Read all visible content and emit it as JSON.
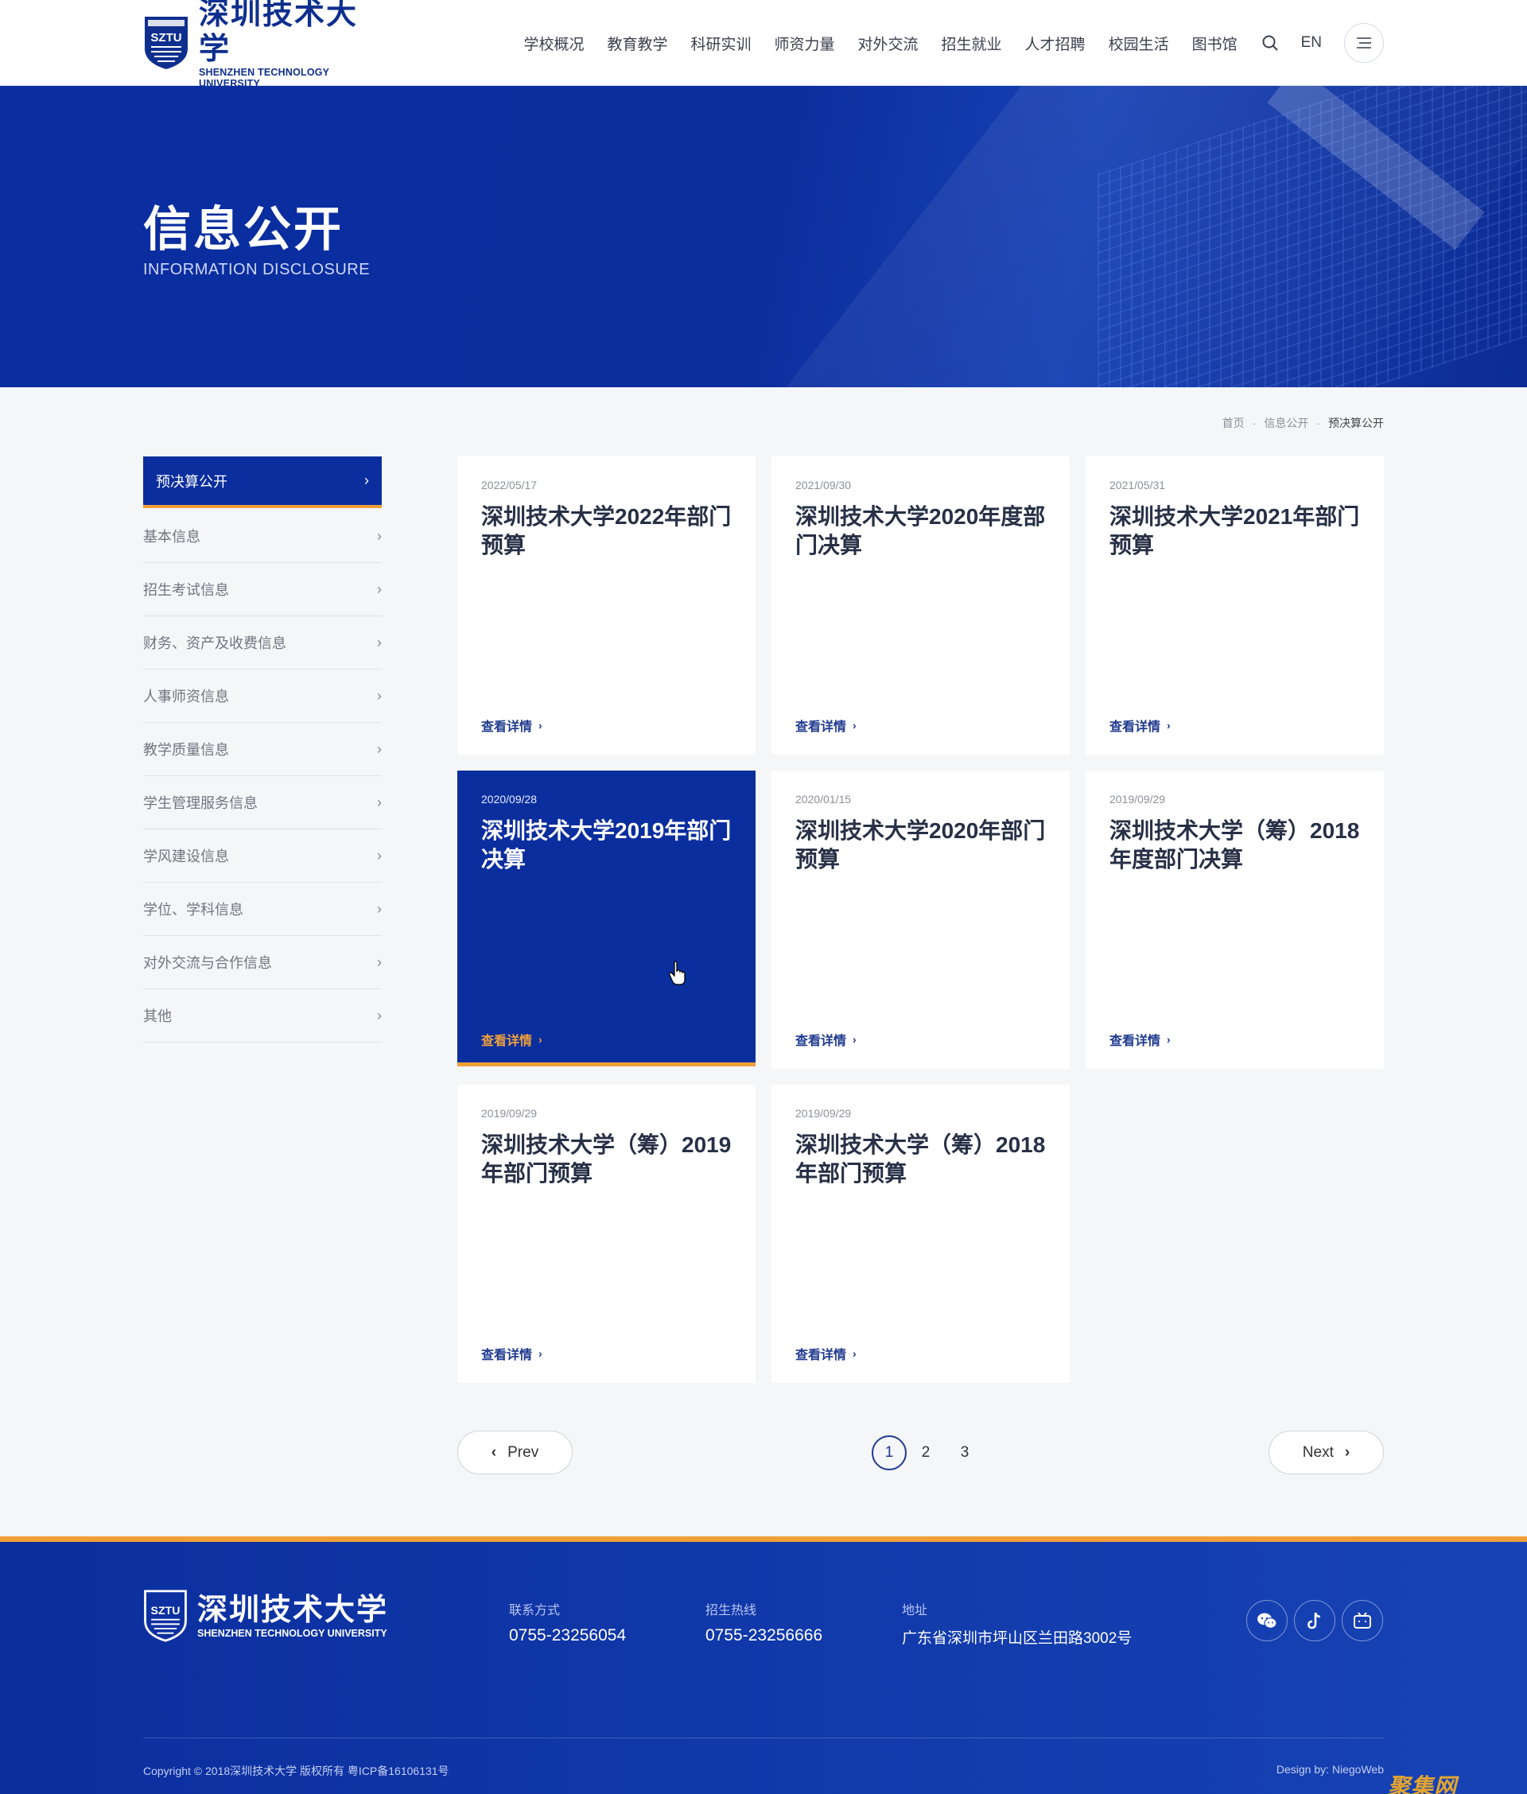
{
  "header": {
    "logo_cn": "深圳技术大学",
    "logo_en": "SHENZHEN TECHNOLOGY UNIVERSITY",
    "logo_abbr": "SZTU",
    "nav": [
      "学校概况",
      "教育教学",
      "科研实训",
      "师资力量",
      "对外交流",
      "招生就业",
      "人才招聘",
      "校园生活",
      "图书馆"
    ],
    "lang": "EN"
  },
  "banner": {
    "title": "信息公开",
    "subtitle": "INFORMATION DISCLOSURE"
  },
  "breadcrumb": [
    "首页",
    "信息公开",
    "预决算公开"
  ],
  "sidebar": {
    "items": [
      {
        "label": "预决算公开",
        "active": true
      },
      {
        "label": "基本信息"
      },
      {
        "label": "招生考试信息"
      },
      {
        "label": "财务、资产及收费信息"
      },
      {
        "label": "人事师资信息"
      },
      {
        "label": "教学质量信息"
      },
      {
        "label": "学生管理服务信息"
      },
      {
        "label": "学风建设信息"
      },
      {
        "label": "学位、学科信息"
      },
      {
        "label": "对外交流与合作信息"
      },
      {
        "label": "其他"
      }
    ]
  },
  "cards": [
    {
      "date": "2022/05/17",
      "title": "深圳技术大学2022年部门预算",
      "more": "查看详情"
    },
    {
      "date": "2021/09/30",
      "title": "深圳技术大学2020年度部门决算",
      "more": "查看详情"
    },
    {
      "date": "2021/05/31",
      "title": "深圳技术大学2021年部门预算",
      "more": "查看详情"
    },
    {
      "date": "2020/09/28",
      "title": "深圳技术大学2019年部门决算",
      "more": "查看详情",
      "highlighted": true
    },
    {
      "date": "2020/01/15",
      "title": "深圳技术大学2020年部门预算",
      "more": "查看详情"
    },
    {
      "date": "2019/09/29",
      "title": "深圳技术大学（筹）2018年度部门决算",
      "more": "查看详情"
    },
    {
      "date": "2019/09/29",
      "title": "深圳技术大学（筹）2019年部门预算",
      "more": "查看详情"
    },
    {
      "date": "2019/09/29",
      "title": "深圳技术大学（筹）2018年部门预算",
      "more": "查看详情"
    }
  ],
  "pagination": {
    "prev": "Prev",
    "next": "Next",
    "pages": [
      "1",
      "2",
      "3"
    ],
    "current": "1"
  },
  "footer": {
    "logo_cn": "深圳技术大学",
    "logo_en": "SHENZHEN TECHNOLOGY UNIVERSITY",
    "logo_abbr": "SZTU",
    "contact_label": "联系方式",
    "contact_value": "0755-23256054",
    "admission_label": "招生热线",
    "admission_value": "0755-23256666",
    "address_label": "地址",
    "address_value": "广东省深圳市坪山区兰田路3002号",
    "social_icons": [
      "wechat-icon",
      "tiktok-icon",
      "bilibili-icon"
    ],
    "copyright": "Copyright © 2018深圳技术大学 版权所有 粤ICP备16106131号",
    "design": "Design by: NiegoWeb",
    "watermark": "聚集网"
  },
  "colors": {
    "primary": "#0b2e9e",
    "accent": "#f1a039"
  }
}
